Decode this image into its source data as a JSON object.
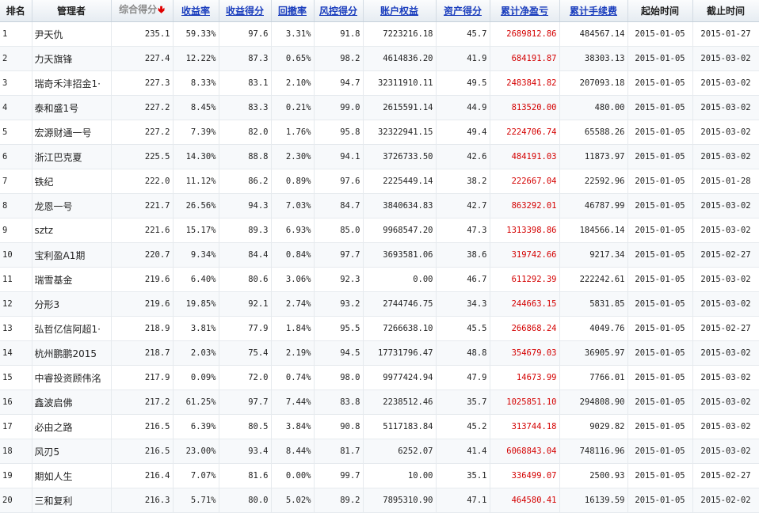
{
  "colors": {
    "accent_link": "#1a3dbd",
    "profit_red": "#d40000",
    "sort_arrow": "#e00000"
  },
  "headers": [
    "排名",
    "管理者",
    "综合得分",
    "收益率",
    "收益得分",
    "回撤率",
    "风控得分",
    "账户权益",
    "资产得分",
    "累计净盈亏",
    "累计手续费",
    "起始时间",
    "截止时间"
  ],
  "sort_icon": "down-arrow-icon",
  "rows": [
    [
      "1",
      "尹天仇",
      "235.1",
      "59.33%",
      "97.6",
      "3.31%",
      "91.8",
      "7223216.18",
      "45.7",
      "2689812.86",
      "484567.14",
      "2015-01-05",
      "2015-01-27"
    ],
    [
      "2",
      "力天旗锋",
      "227.4",
      "12.22%",
      "87.3",
      "0.65%",
      "98.2",
      "4614836.20",
      "41.9",
      "684191.87",
      "38303.13",
      "2015-01-05",
      "2015-03-02"
    ],
    [
      "3",
      "瑞奇禾沣招金1·",
      "227.3",
      "8.33%",
      "83.1",
      "2.10%",
      "94.7",
      "32311910.11",
      "49.5",
      "2483841.82",
      "207093.18",
      "2015-01-05",
      "2015-03-02"
    ],
    [
      "4",
      "泰和盛1号",
      "227.2",
      "8.45%",
      "83.3",
      "0.21%",
      "99.0",
      "2615591.14",
      "44.9",
      "813520.00",
      "480.00",
      "2015-01-05",
      "2015-03-02"
    ],
    [
      "5",
      "宏源财通一号",
      "227.2",
      "7.39%",
      "82.0",
      "1.76%",
      "95.8",
      "32322941.15",
      "49.4",
      "2224706.74",
      "65588.26",
      "2015-01-05",
      "2015-03-02"
    ],
    [
      "6",
      "浙江巴克夏",
      "225.5",
      "14.30%",
      "88.8",
      "2.30%",
      "94.1",
      "3726733.50",
      "42.6",
      "484191.03",
      "11873.97",
      "2015-01-05",
      "2015-03-02"
    ],
    [
      "7",
      "铁纪",
      "222.0",
      "11.12%",
      "86.2",
      "0.89%",
      "97.6",
      "2225449.14",
      "38.2",
      "222667.04",
      "22592.96",
      "2015-01-05",
      "2015-01-28"
    ],
    [
      "8",
      "龙恩一号",
      "221.7",
      "26.56%",
      "94.3",
      "7.03%",
      "84.7",
      "3840634.83",
      "42.7",
      "863292.01",
      "46787.99",
      "2015-01-05",
      "2015-03-02"
    ],
    [
      "9",
      "sztz",
      "221.6",
      "15.17%",
      "89.3",
      "6.93%",
      "85.0",
      "9968547.20",
      "47.3",
      "1313398.86",
      "184566.14",
      "2015-01-05",
      "2015-03-02"
    ],
    [
      "10",
      "宝利盈A1期",
      "220.7",
      "9.34%",
      "84.4",
      "0.84%",
      "97.7",
      "3693581.06",
      "38.6",
      "319742.66",
      "9217.34",
      "2015-01-05",
      "2015-02-27"
    ],
    [
      "11",
      "瑞雪基金",
      "219.6",
      "6.40%",
      "80.6",
      "3.06%",
      "92.3",
      "0.00",
      "46.7",
      "611292.39",
      "222242.61",
      "2015-01-05",
      "2015-03-02"
    ],
    [
      "12",
      "分形3",
      "219.6",
      "19.85%",
      "92.1",
      "2.74%",
      "93.2",
      "2744746.75",
      "34.3",
      "244663.15",
      "5831.85",
      "2015-01-05",
      "2015-03-02"
    ],
    [
      "13",
      "弘哲亿信阿超1·",
      "218.9",
      "3.81%",
      "77.9",
      "1.84%",
      "95.5",
      "7266638.10",
      "45.5",
      "266868.24",
      "4049.76",
      "2015-01-05",
      "2015-02-27"
    ],
    [
      "14",
      "杭州鹏鹏2015",
      "218.7",
      "2.03%",
      "75.4",
      "2.19%",
      "94.5",
      "17731796.47",
      "48.8",
      "354679.03",
      "36905.97",
      "2015-01-05",
      "2015-03-02"
    ],
    [
      "15",
      "中睿投资顾伟洺",
      "217.9",
      "0.09%",
      "72.0",
      "0.74%",
      "98.0",
      "9977424.94",
      "47.9",
      "14673.99",
      "7766.01",
      "2015-01-05",
      "2015-03-02"
    ],
    [
      "16",
      "鑫波启佛",
      "217.2",
      "61.25%",
      "97.7",
      "7.44%",
      "83.8",
      "2238512.46",
      "35.7",
      "1025851.10",
      "294808.90",
      "2015-01-05",
      "2015-03-02"
    ],
    [
      "17",
      "必由之路",
      "216.5",
      "6.39%",
      "80.5",
      "3.84%",
      "90.8",
      "5117183.84",
      "45.2",
      "313744.18",
      "9029.82",
      "2015-01-05",
      "2015-03-02"
    ],
    [
      "18",
      "风刃5",
      "216.5",
      "23.00%",
      "93.4",
      "8.44%",
      "81.7",
      "6252.07",
      "41.4",
      "6068843.04",
      "748116.96",
      "2015-01-05",
      "2015-03-02"
    ],
    [
      "19",
      "期如人生",
      "216.4",
      "7.07%",
      "81.6",
      "0.00%",
      "99.7",
      "10.00",
      "35.1",
      "336499.07",
      "2500.93",
      "2015-01-05",
      "2015-02-27"
    ],
    [
      "20",
      "三和复利",
      "216.3",
      "5.71%",
      "80.0",
      "5.02%",
      "89.2",
      "7895310.90",
      "47.1",
      "464580.41",
      "16139.59",
      "2015-01-05",
      "2015-02-02"
    ]
  ]
}
